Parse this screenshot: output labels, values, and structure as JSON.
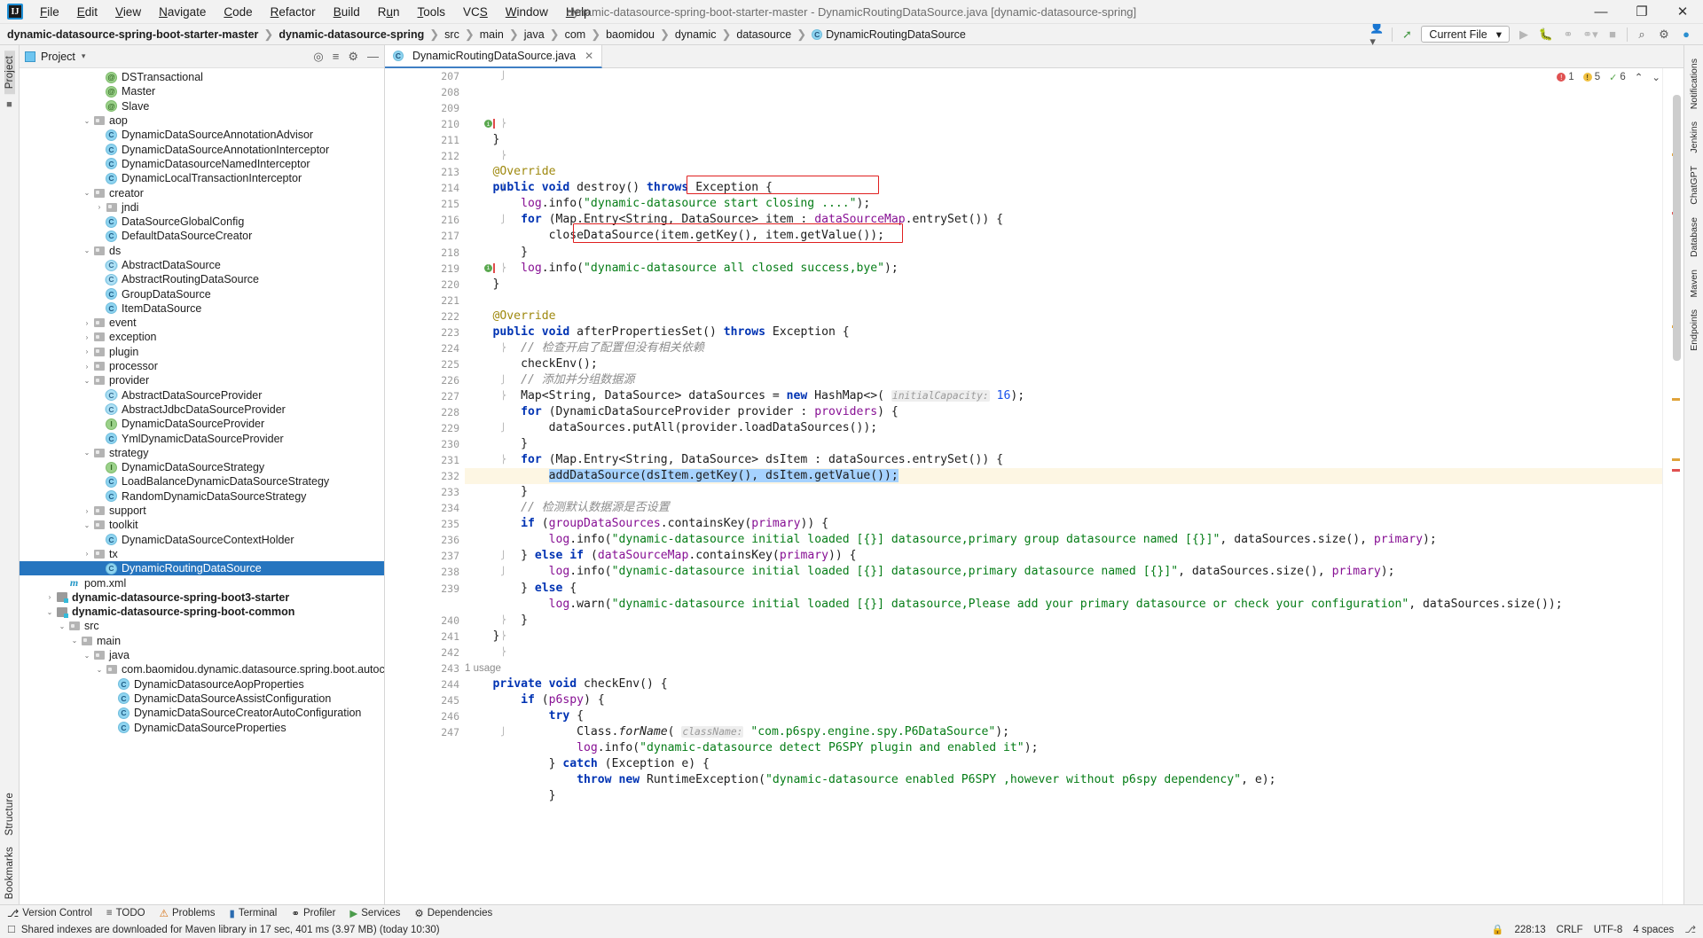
{
  "window": {
    "title": "dynamic-datasource-spring-boot-starter-master - DynamicRoutingDataSource.java [dynamic-datasource-spring]",
    "logo": "IJ",
    "minimize": "—",
    "maximize": "❐",
    "close": "✕"
  },
  "menu": [
    {
      "label": "File"
    },
    {
      "label": "Edit"
    },
    {
      "label": "View"
    },
    {
      "label": "Navigate"
    },
    {
      "label": "Code"
    },
    {
      "label": "Refactor"
    },
    {
      "label": "Build"
    },
    {
      "label": "Run"
    },
    {
      "label": "Tools"
    },
    {
      "label": "VCS"
    },
    {
      "label": "Window"
    },
    {
      "label": "Help"
    }
  ],
  "breadcrumbs": [
    {
      "label": "dynamic-datasource-spring-boot-starter-master",
      "bold": true
    },
    {
      "label": "dynamic-datasource-spring",
      "bold": true
    },
    {
      "label": "src"
    },
    {
      "label": "main"
    },
    {
      "label": "java"
    },
    {
      "label": "com"
    },
    {
      "label": "baomidou"
    },
    {
      "label": "dynamic"
    },
    {
      "label": "datasource"
    },
    {
      "label": "DynamicRoutingDataSource",
      "icon": "C"
    }
  ],
  "toolbar": {
    "run_config": "Current File",
    "dropdown_caret": "▾",
    "profile_icon": "profile-icon",
    "build_icon": "build-hammer-icon",
    "run_icon": "▶",
    "debug_icon": "debug-bug-icon",
    "coverage_icon": "coverage-icon",
    "profiler_icon": "profiler-icon",
    "stop_icon": "■",
    "search_icon": "⌕",
    "settings_icon": "⚙",
    "ai_icon": "ai-assistant-icon"
  },
  "left_rail": {
    "project_label": "Project",
    "structure_label": "Structure",
    "bookmarks_label": "Bookmarks",
    "commit_icon": "commit-icon"
  },
  "right_rail": [
    {
      "label": "Notifications"
    },
    {
      "label": "Jenkins"
    },
    {
      "label": "ChatGPT"
    },
    {
      "label": "Database"
    },
    {
      "label": "Maven"
    },
    {
      "label": "Endpoints"
    }
  ],
  "project_panel": {
    "title": "Project",
    "caret": "▾",
    "locate_icon": "locate-target-icon",
    "collapse_icon": "collapse-all-icon",
    "settings_icon": "⚙",
    "hide_icon": "—",
    "tree": [
      {
        "indent": 6,
        "arrow": "",
        "icon": "annotation",
        "label": "DSTransactional"
      },
      {
        "indent": 6,
        "arrow": "",
        "icon": "annotation",
        "label": "Master"
      },
      {
        "indent": 6,
        "arrow": "",
        "icon": "annotation",
        "label": "Slave"
      },
      {
        "indent": 5,
        "arrow": "⌄",
        "icon": "folder",
        "label": "aop"
      },
      {
        "indent": 6,
        "arrow": "",
        "icon": "class",
        "label": "DynamicDataSourceAnnotationAdvisor"
      },
      {
        "indent": 6,
        "arrow": "",
        "icon": "class",
        "label": "DynamicDataSourceAnnotationInterceptor"
      },
      {
        "indent": 6,
        "arrow": "",
        "icon": "class",
        "label": "DynamicDatasourceNamedInterceptor"
      },
      {
        "indent": 6,
        "arrow": "",
        "icon": "class",
        "label": "DynamicLocalTransactionInterceptor"
      },
      {
        "indent": 5,
        "arrow": "⌄",
        "icon": "folder",
        "label": "creator"
      },
      {
        "indent": 6,
        "arrow": "›",
        "icon": "folder",
        "label": "jndi"
      },
      {
        "indent": 6,
        "arrow": "",
        "icon": "class",
        "label": "DataSourceGlobalConfig"
      },
      {
        "indent": 6,
        "arrow": "",
        "icon": "class",
        "label": "DefaultDataSourceCreator"
      },
      {
        "indent": 5,
        "arrow": "⌄",
        "icon": "folder",
        "label": "ds"
      },
      {
        "indent": 6,
        "arrow": "",
        "icon": "abstract",
        "label": "AbstractDataSource"
      },
      {
        "indent": 6,
        "arrow": "",
        "icon": "abstract",
        "label": "AbstractRoutingDataSource"
      },
      {
        "indent": 6,
        "arrow": "",
        "icon": "class",
        "label": "GroupDataSource"
      },
      {
        "indent": 6,
        "arrow": "",
        "icon": "class",
        "label": "ItemDataSource"
      },
      {
        "indent": 5,
        "arrow": "›",
        "icon": "folder",
        "label": "event"
      },
      {
        "indent": 5,
        "arrow": "›",
        "icon": "folder",
        "label": "exception"
      },
      {
        "indent": 5,
        "arrow": "›",
        "icon": "folder",
        "label": "plugin"
      },
      {
        "indent": 5,
        "arrow": "›",
        "icon": "folder",
        "label": "processor"
      },
      {
        "indent": 5,
        "arrow": "⌄",
        "icon": "folder",
        "label": "provider"
      },
      {
        "indent": 6,
        "arrow": "",
        "icon": "abstract",
        "label": "AbstractDataSourceProvider"
      },
      {
        "indent": 6,
        "arrow": "",
        "icon": "abstract",
        "label": "AbstractJdbcDataSourceProvider"
      },
      {
        "indent": 6,
        "arrow": "",
        "icon": "interface",
        "label": "DynamicDataSourceProvider"
      },
      {
        "indent": 6,
        "arrow": "",
        "icon": "class",
        "label": "YmlDynamicDataSourceProvider"
      },
      {
        "indent": 5,
        "arrow": "⌄",
        "icon": "folder",
        "label": "strategy"
      },
      {
        "indent": 6,
        "arrow": "",
        "icon": "interface",
        "label": "DynamicDataSourceStrategy"
      },
      {
        "indent": 6,
        "arrow": "",
        "icon": "class",
        "label": "LoadBalanceDynamicDataSourceStrategy"
      },
      {
        "indent": 6,
        "arrow": "",
        "icon": "class",
        "label": "RandomDynamicDataSourceStrategy"
      },
      {
        "indent": 5,
        "arrow": "›",
        "icon": "folder",
        "label": "support"
      },
      {
        "indent": 5,
        "arrow": "⌄",
        "icon": "folder",
        "label": "toolkit"
      },
      {
        "indent": 6,
        "arrow": "",
        "icon": "class",
        "label": "DynamicDataSourceContextHolder"
      },
      {
        "indent": 5,
        "arrow": "›",
        "icon": "folder",
        "label": "tx"
      },
      {
        "indent": 6,
        "arrow": "",
        "icon": "class",
        "label": "DynamicRoutingDataSource",
        "selected": true
      },
      {
        "indent": 3,
        "arrow": "",
        "icon": "maven",
        "label": "pom.xml"
      },
      {
        "indent": 2,
        "arrow": "›",
        "icon": "module",
        "label": "dynamic-datasource-spring-boot3-starter",
        "bold": true
      },
      {
        "indent": 2,
        "arrow": "⌄",
        "icon": "module",
        "label": "dynamic-datasource-spring-boot-common",
        "bold": true
      },
      {
        "indent": 3,
        "arrow": "⌄",
        "icon": "folder",
        "label": "src"
      },
      {
        "indent": 4,
        "arrow": "⌄",
        "icon": "folder",
        "label": "main"
      },
      {
        "indent": 5,
        "arrow": "⌄",
        "icon": "folder",
        "label": "java"
      },
      {
        "indent": 6,
        "arrow": "⌄",
        "icon": "folder",
        "label": "com.baomidou.dynamic.datasource.spring.boot.autoconfigure"
      },
      {
        "indent": 7,
        "arrow": "",
        "icon": "class",
        "label": "DynamicDatasourceAopProperties"
      },
      {
        "indent": 7,
        "arrow": "",
        "icon": "class",
        "label": "DynamicDataSourceAssistConfiguration"
      },
      {
        "indent": 7,
        "arrow": "",
        "icon": "class",
        "label": "DynamicDataSourceCreatorAutoConfiguration"
      },
      {
        "indent": 7,
        "arrow": "",
        "icon": "class",
        "label": "DynamicDataSourceProperties"
      }
    ]
  },
  "editor": {
    "tab_label": "DynamicRoutingDataSource.java",
    "tab_icon": "C",
    "tab_close": "✕",
    "inspections": {
      "errors": "1",
      "warnings": "5",
      "weak_warnings": "6",
      "ok_icon": "✓",
      "expand_icon": "⌃",
      "caret_icon": "⌄"
    },
    "first_line": 207,
    "lines": [
      {
        "n": 207,
        "fold": "end"
      },
      {
        "n": 208
      },
      {
        "n": 209
      },
      {
        "n": 210,
        "mark": true,
        "fold": "start"
      },
      {
        "n": 211
      },
      {
        "n": 212,
        "fold": "start"
      },
      {
        "n": 213
      },
      {
        "n": 214,
        "fold": "end"
      },
      {
        "n": 215
      },
      {
        "n": 216,
        "fold": "end"
      },
      {
        "n": 217
      },
      {
        "n": 218
      },
      {
        "n": 219,
        "mark": true,
        "fold": "start"
      },
      {
        "n": 220
      },
      {
        "n": 221
      },
      {
        "n": 222
      },
      {
        "n": 223
      },
      {
        "n": 224,
        "fold": "start"
      },
      {
        "n": 225
      },
      {
        "n": 226,
        "fold": "end"
      },
      {
        "n": 227,
        "fold": "start"
      },
      {
        "n": 228
      },
      {
        "n": 229,
        "fold": "end"
      },
      {
        "n": 230
      },
      {
        "n": 231,
        "fold": "start"
      },
      {
        "n": 232
      },
      {
        "n": 233
      },
      {
        "n": 234
      },
      {
        "n": 235
      },
      {
        "n": 236
      },
      {
        "n": 237,
        "fold": "end"
      },
      {
        "n": 238,
        "fold": "end"
      },
      {
        "n": 239
      },
      {
        "n": ""
      },
      {
        "n": 240,
        "fold": "start"
      },
      {
        "n": 241,
        "fold": "start"
      },
      {
        "n": 242,
        "fold": "start"
      },
      {
        "n": 243
      },
      {
        "n": 244
      },
      {
        "n": 245
      },
      {
        "n": 246
      },
      {
        "n": 247,
        "fold": "end"
      }
    ],
    "usage_hint": "1 usage",
    "code_text": [
      "    }",
      "",
      "    @Override",
      "    public void destroy() throws Exception {",
      "        log.info(\"dynamic-datasource start closing ....\");",
      "        for (Map.Entry<String, DataSource> item : dataSourceMap.entrySet()) {",
      "            closeDataSource(item.getKey(), item.getValue());",
      "        }",
      "        log.info(\"dynamic-datasource all closed success,bye\");",
      "    }",
      "",
      "    @Override",
      "    public void afterPropertiesSet() throws Exception {",
      "        // 检查开启了配置但没有相关依赖",
      "        checkEnv();",
      "        // 添加并分组数据源",
      "        Map<String, DataSource> dataSources = new HashMap<>( initialCapacity: 16);",
      "        for (DynamicDataSourceProvider provider : providers) {",
      "            dataSources.putAll(provider.loadDataSources());",
      "        }",
      "        for (Map.Entry<String, DataSource> dsItem : dataSources.entrySet()) {",
      "            addDataSource(dsItem.getKey(), dsItem.getValue());",
      "        }",
      "        // 检测默认数据源是否设置",
      "        if (groupDataSources.containsKey(primary)) {",
      "            log.info(\"dynamic-datasource initial loaded [{}] datasource,primary group datasource named [{}]\", dataSources.size(), primary);",
      "        } else if (dataSourceMap.containsKey(primary)) {",
      "            log.info(\"dynamic-datasource initial loaded [{}] datasource,primary datasource named [{}]\", dataSources.size(), primary);",
      "        } else {",
      "            log.warn(\"dynamic-datasource initial loaded [{}] datasource,Please add your primary datasource or check your configuration\", dataSources.size());",
      "        }",
      "    }",
      "",
      "1 usage",
      "    private void checkEnv() {",
      "        if (p6spy) {",
      "            try {",
      "                Class.forName( className: \"com.p6spy.engine.spy.P6DataSource\");",
      "                log.info(\"dynamic-datasource detect P6SPY plugin and enabled it\");",
      "            } catch (Exception e) {",
      "                throw new RuntimeException(\"dynamic-datasource enabled P6SPY ,however without p6spy dependency\", e);",
      "            }"
    ],
    "annotations": {
      "red_box_1": "provider.loadDataSources()",
      "red_box_2": "addDataSource(dsItem.getKey(), dsItem.getValue());"
    }
  },
  "bottom_tools": [
    {
      "label": "Version Control",
      "icon": "branch-icon"
    },
    {
      "label": "TODO",
      "icon": "list-icon"
    },
    {
      "label": "Problems",
      "icon": "warning-icon"
    },
    {
      "label": "Terminal",
      "icon": "terminal-icon"
    },
    {
      "label": "Profiler",
      "icon": "profiler-icon"
    },
    {
      "label": "Services",
      "icon": "services-icon"
    },
    {
      "label": "Dependencies",
      "icon": "dependencies-icon"
    }
  ],
  "status_bar": {
    "message_icon": "message-icon",
    "message": "Shared indexes are downloaded for Maven library in 17 sec, 401 ms (3.97 MB) (today 10:30)",
    "caret_position": "228:13",
    "line_sep": "CRLF",
    "encoding": "UTF-8",
    "indent": "4 spaces",
    "lock_icon": "lock-icon",
    "branch_icon": "branch-icon"
  },
  "colors": {
    "accent_blue": "#2675bf",
    "keyword": "#0033b3",
    "string": "#067d17",
    "comment": "#8c8c8c",
    "annotation": "#9e880d",
    "field": "#871094",
    "highlight_red": "#e02020",
    "selection": "#a6d2ff",
    "line_highlight": "#fdf6e3"
  }
}
